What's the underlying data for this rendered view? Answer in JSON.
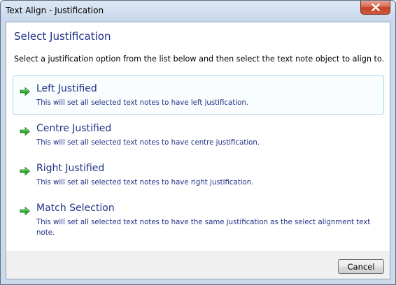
{
  "window": {
    "title": "Text Align - Justification",
    "close_icon": "close-icon"
  },
  "header": {
    "heading": "Select Justification",
    "instruction": "Select a justification option from the list below and then select the text note object to align to."
  },
  "options": [
    {
      "title": "Left Justified",
      "description": "This will set all selected text notes to have left justification.",
      "icon": "green-arrow-right-icon",
      "selected": true
    },
    {
      "title": "Centre Justified",
      "description": "This will set all selected text notes to have centre justification.",
      "icon": "green-arrow-right-icon",
      "selected": false
    },
    {
      "title": "Right Justified",
      "description": "This will set all selected text notes to have right justification.",
      "icon": "green-arrow-right-icon",
      "selected": false
    },
    {
      "title": "Match Selection",
      "description": "This will set all selected text notes to have the same justification as the select alignment text note.",
      "icon": "green-arrow-right-icon",
      "selected": false
    }
  ],
  "footer": {
    "cancel_label": "Cancel"
  },
  "colors": {
    "link_blue": "#1e3287",
    "arrow_green": "#2fa52f",
    "selection_border": "#a9d9e8",
    "close_red": "#c14528"
  }
}
